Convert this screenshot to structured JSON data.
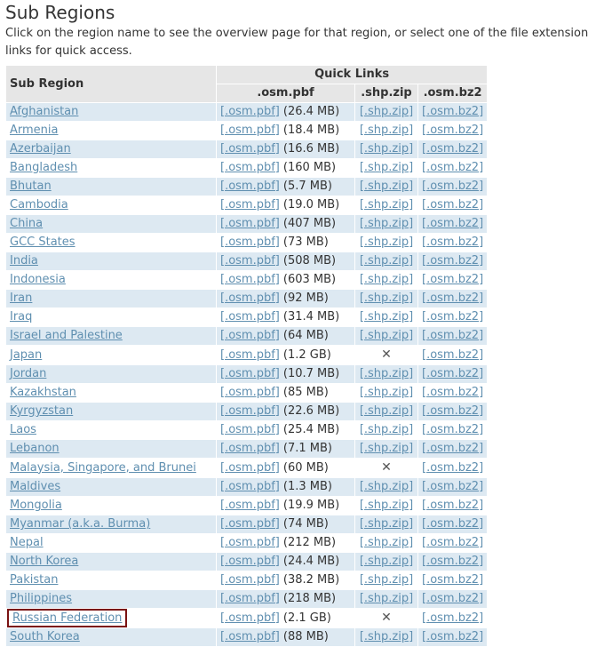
{
  "page": {
    "title": "Sub Regions",
    "intro": "Click on the region name to see the overview page for that region, or select one of the file extension links for quick access."
  },
  "table": {
    "header_subregion": "Sub Region",
    "header_quicklinks": "Quick Links",
    "col_pbf": ".osm.pbf",
    "col_shp": ".shp.zip",
    "col_bz2": ".osm.bz2",
    "link_pbf": "[.osm.pbf]",
    "link_shp": "[.shp.zip]",
    "link_bz2": "[.osm.bz2]",
    "unavailable_icon": "cross-icon",
    "rows": [
      {
        "name": "Afghanistan",
        "size": "(26.4 MB)",
        "shp": true
      },
      {
        "name": "Armenia",
        "size": "(18.4 MB)",
        "shp": true
      },
      {
        "name": "Azerbaijan",
        "size": "(16.6 MB)",
        "shp": true
      },
      {
        "name": "Bangladesh",
        "size": "(160 MB)",
        "shp": true
      },
      {
        "name": "Bhutan",
        "size": "(5.7 MB)",
        "shp": true
      },
      {
        "name": "Cambodia",
        "size": "(19.0 MB)",
        "shp": true
      },
      {
        "name": "China",
        "size": "(407 MB)",
        "shp": true
      },
      {
        "name": "GCC States",
        "size": "(73 MB)",
        "shp": true
      },
      {
        "name": "India",
        "size": "(508 MB)",
        "shp": true
      },
      {
        "name": "Indonesia",
        "size": "(603 MB)",
        "shp": true
      },
      {
        "name": "Iran",
        "size": "(92 MB)",
        "shp": true
      },
      {
        "name": "Iraq",
        "size": "(31.4 MB)",
        "shp": true
      },
      {
        "name": "Israel and Palestine",
        "size": "(64 MB)",
        "shp": true
      },
      {
        "name": "Japan",
        "size": "(1.2 GB)",
        "shp": false
      },
      {
        "name": "Jordan",
        "size": "(10.7 MB)",
        "shp": true
      },
      {
        "name": "Kazakhstan",
        "size": "(85 MB)",
        "shp": true
      },
      {
        "name": "Kyrgyzstan",
        "size": "(22.6 MB)",
        "shp": true
      },
      {
        "name": "Laos",
        "size": "(25.4 MB)",
        "shp": true
      },
      {
        "name": "Lebanon",
        "size": "(7.1 MB)",
        "shp": true
      },
      {
        "name": "Malaysia, Singapore, and Brunei",
        "size": "(60 MB)",
        "shp": false
      },
      {
        "name": "Maldives",
        "size": "(1.3 MB)",
        "shp": true
      },
      {
        "name": "Mongolia",
        "size": "(19.9 MB)",
        "shp": true
      },
      {
        "name": "Myanmar (a.k.a. Burma)",
        "size": "(74 MB)",
        "shp": true
      },
      {
        "name": "Nepal",
        "size": "(212 MB)",
        "shp": true
      },
      {
        "name": "North Korea",
        "size": "(24.4 MB)",
        "shp": true
      },
      {
        "name": "Pakistan",
        "size": "(38.2 MB)",
        "shp": true
      },
      {
        "name": "Philippines",
        "size": "(218 MB)",
        "shp": true
      },
      {
        "name": "Russian Federation",
        "size": "(2.1 GB)",
        "shp": false,
        "highlighted": true
      },
      {
        "name": "South Korea",
        "size": "(88 MB)",
        "shp": true
      }
    ]
  }
}
